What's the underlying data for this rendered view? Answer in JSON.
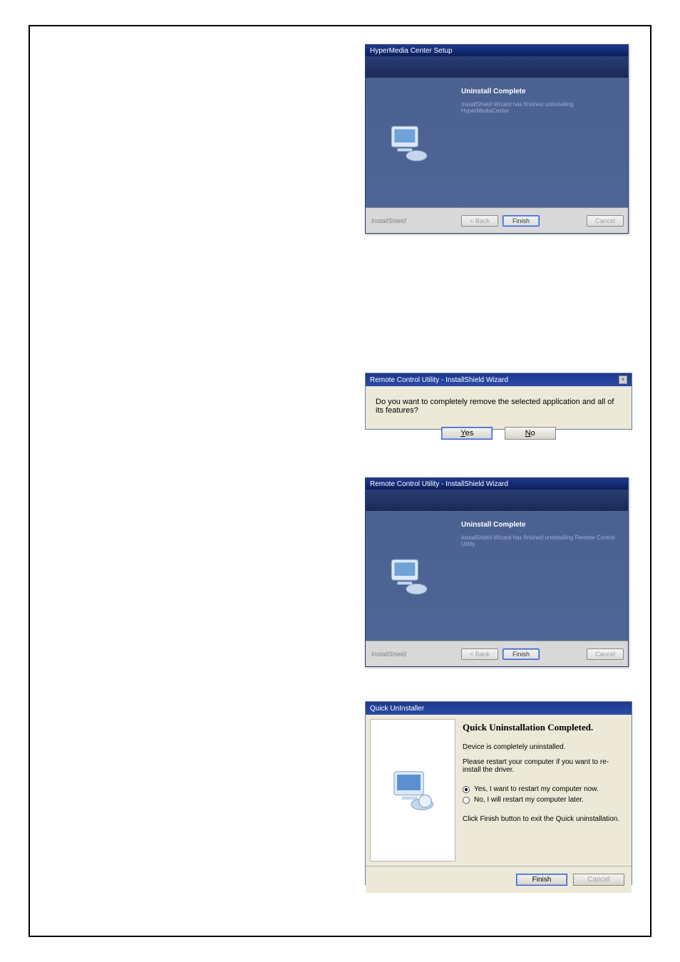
{
  "win1": {
    "title": "HyperMedia Center Setup",
    "heading": "Uninstall Complete",
    "sub": "InstallShield Wizard has finished uninstalling HyperMediaCenter.",
    "brand": "InstallShield",
    "back": "< Back",
    "finish": "Finish",
    "cancel": "Cancel"
  },
  "dlg": {
    "title": "Remote Control Utility - InstallShield Wizard",
    "question": "Do you want to completely remove the selected application and all of its features?",
    "yes_pre": "Y",
    "yes_rest": "es",
    "no_pre": "N",
    "no_rest": "o"
  },
  "win2": {
    "title": "Remote Control Utility - InstallShield Wizard",
    "heading": "Uninstall Complete",
    "sub": "InstallShield Wizard has finished uninstalling Remote Control Utility.",
    "brand": "InstallShield",
    "back": "< Back",
    "finish": "Finish",
    "cancel": "Cancel"
  },
  "quick": {
    "title": "Quick UnInstaller",
    "heading": "Quick Uninstallation Completed.",
    "l1": "Device is completely uninstalled.",
    "l2": "Please restart your computer if you want to re-install the driver.",
    "opt1": "Yes, I want to restart my computer now.",
    "opt2": "No, I will restart my computer later.",
    "l3": "Click Finish button to exit the Quick uninstallation.",
    "finish": "Finish",
    "cancel": "Cancel",
    "selected": "yes"
  }
}
